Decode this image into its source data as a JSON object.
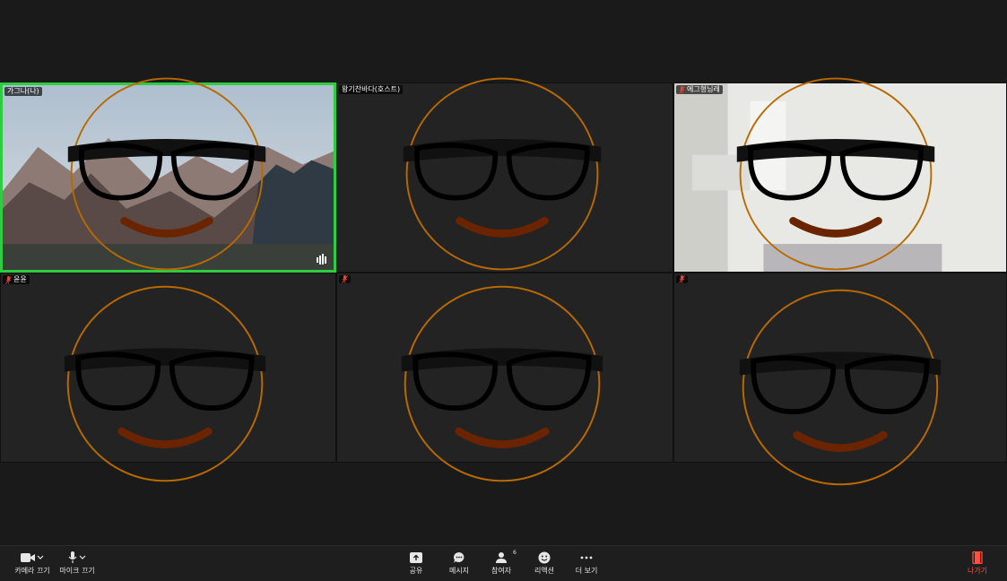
{
  "participants": [
    {
      "name": "가그나(나)",
      "muted": false,
      "speaking": true
    },
    {
      "name": "왕기찬바다(호스트)",
      "muted": false,
      "speaking": false
    },
    {
      "name": "에그형님레",
      "muted": true,
      "speaking": false
    },
    {
      "name": "윤윤",
      "muted": true,
      "speaking": false
    },
    {
      "name": "",
      "muted": true,
      "speaking": false
    },
    {
      "name": "",
      "muted": true,
      "speaking": false
    }
  ],
  "toolbar": {
    "camera_label": "카메라 끄기",
    "mic_label": "마이크 끄기",
    "share_label": "공유",
    "chat_label": "메시지",
    "participants_label": "참여자",
    "participants_count": "6",
    "reaction_label": "리액션",
    "more_label": "더 보기",
    "leave_label": "나가기"
  },
  "colors": {
    "active_speaker_border": "#2ecc40",
    "leave": "#ff4f3f",
    "background": "#1a1a1a"
  }
}
